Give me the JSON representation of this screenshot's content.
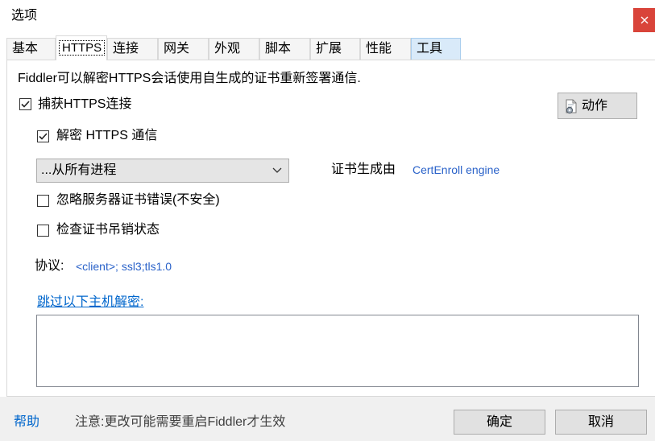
{
  "window": {
    "title": "选项"
  },
  "tabs": [
    {
      "label": "基本"
    },
    {
      "label": "HTTPS"
    },
    {
      "label": "连接"
    },
    {
      "label": "网关"
    },
    {
      "label": "外观"
    },
    {
      "label": "脚本"
    },
    {
      "label": "扩展"
    },
    {
      "label": "性能"
    },
    {
      "label": "工具"
    }
  ],
  "selected_tab_index": 1,
  "hovered_tab_index": 8,
  "https": {
    "description": "Fiddler可以解密HTTPS会话使用自生成的证书重新签署通信.",
    "capture_https": {
      "label": "捕获HTTPS连接",
      "checked": true
    },
    "actions_button": {
      "label": "动作",
      "icon": "certificate-gear-icon"
    },
    "decrypt_https": {
      "label": "解密 HTTPS 通信",
      "checked": true
    },
    "process_filter": {
      "selected": "...从所有进程"
    },
    "certificate_generator": {
      "label": "证书生成由",
      "value": "CertEnroll engine"
    },
    "ignore_server_cert_errors": {
      "label": "忽略服务器证书错误(不安全)",
      "checked": false
    },
    "check_revocation": {
      "label": "检查证书吊销状态",
      "checked": false
    },
    "protocols": {
      "label": "协议:",
      "value": "<client>; ssl3;tls1.0"
    },
    "skip_decryption": {
      "link_label": "跳过以下主机解密:",
      "hosts": ""
    }
  },
  "footer": {
    "help_label": "帮助",
    "note": "注意:更改可能需要重启Fiddler才生效",
    "ok_label": "确定",
    "cancel_label": "取消"
  },
  "colors": {
    "close_button_bg": "#d9443a",
    "link_blue": "#0066cc",
    "value_blue": "#2a62c9",
    "hover_tab_bg": "#d9eaf9",
    "dialog_bg": "#f0f0f0"
  }
}
